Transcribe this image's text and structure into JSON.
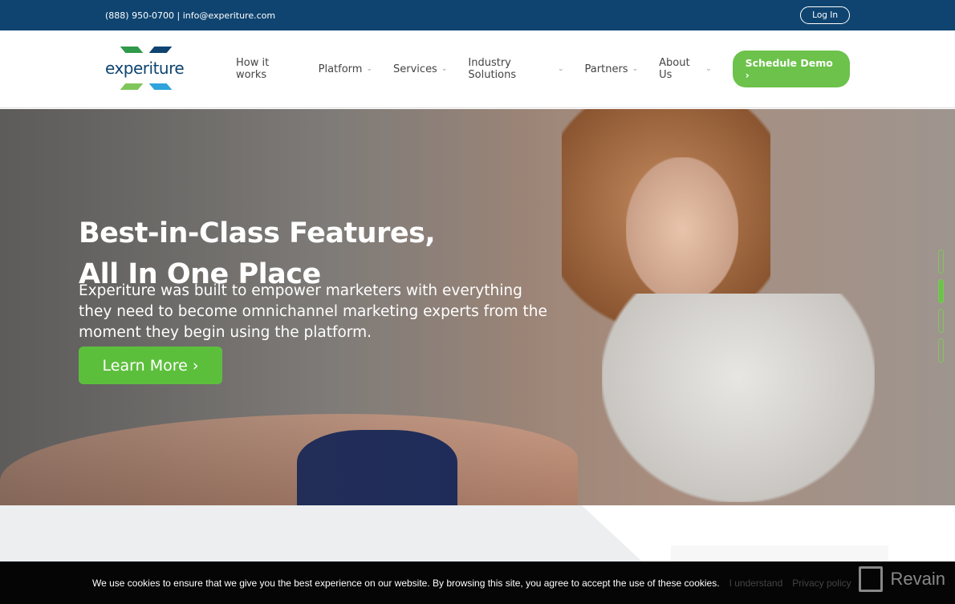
{
  "topbar": {
    "contact": "(888) 950-0700  |  info@experiture.com",
    "login": "Log In"
  },
  "logo": {
    "text": "experiture"
  },
  "nav": {
    "items": [
      {
        "label": "How it works",
        "dropdown": false
      },
      {
        "label": "Platform",
        "dropdown": true
      },
      {
        "label": "Services",
        "dropdown": true
      },
      {
        "label": "Industry Solutions",
        "dropdown": true
      },
      {
        "label": "Partners",
        "dropdown": true
      },
      {
        "label": "About Us",
        "dropdown": true
      }
    ],
    "cta": "Schedule Demo  ›"
  },
  "hero": {
    "title_line1": "Best-in-Class Features,",
    "title_line2": "All In One Place",
    "text": "Experiture was built to empower marketers with everything they need to become omnichannel marketing experts from the moment they begin using the platform.",
    "button": "Learn More ›",
    "slides": 4,
    "active_slide": 2
  },
  "cookie": {
    "text": "We use cookies to ensure that we give you the best experience on our website. By browsing this site, you agree to accept the use of these cookies.",
    "accept": "I understand",
    "policy": "Privacy policy"
  },
  "watermark": {
    "text": "Revain"
  },
  "colors": {
    "brand_blue": "#0f4470",
    "brand_green": "#6cc24a"
  }
}
